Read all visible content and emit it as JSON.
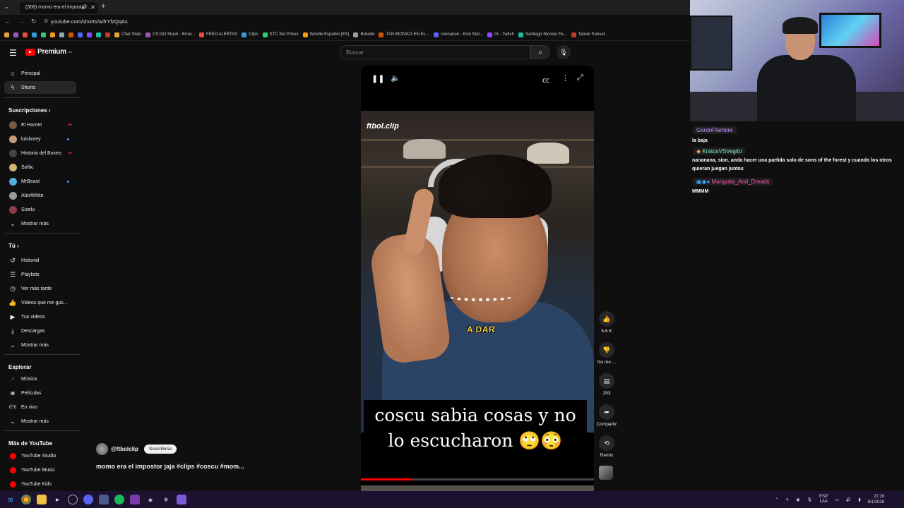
{
  "browser": {
    "tab_title": "(306) momo era el impostor ...",
    "url": "youtube.com/shorts/wifrYfzQqAs",
    "bookmarks": [
      "Chat Stats",
      "CS:GO Stash - Brow...",
      "FEED ALERTAS",
      "Clips",
      "STC Set Prices",
      "Wordle Español (ES)",
      "Boludle",
      "TAN BIONICA EN EL...",
      "coxnanon - Kick Stat...",
      "trr - Twitch",
      "Santiago Nicolas Fe...",
      "Tanuki Sunset"
    ]
  },
  "youtube": {
    "logo_text": "Premium",
    "logo_sup": "AR",
    "search_placeholder": "Buscar",
    "sidebar": {
      "main": [
        {
          "label": "Principal",
          "icon": "home-icon"
        },
        {
          "label": "Shorts",
          "icon": "shorts-icon"
        }
      ],
      "subs_header": "Suscripciones",
      "subs": [
        {
          "label": "El Hornet",
          "color": "#7a5a44"
        },
        {
          "label": "luisitorey",
          "color": "#c49b7a"
        },
        {
          "label": "Historia del Boxeo",
          "color": "#444"
        },
        {
          "label": "Softic",
          "color": "#d8b270"
        },
        {
          "label": "MrBeast",
          "color": "#4fb0d9"
        },
        {
          "label": "AlexWhite",
          "color": "#9a9a9a"
        },
        {
          "label": "Sizelu",
          "color": "#8a3d4a"
        }
      ],
      "show_more": "Mostrar más",
      "you_header": "Tú",
      "you": [
        {
          "label": "Historial",
          "icon": "history-icon"
        },
        {
          "label": "Playlists",
          "icon": "playlist-icon"
        },
        {
          "label": "Ver más tarde",
          "icon": "clock-icon"
        },
        {
          "label": "Videos que me gus...",
          "icon": "like-icon"
        },
        {
          "label": "Tus videos",
          "icon": "video-icon"
        },
        {
          "label": "Descargas",
          "icon": "download-icon"
        }
      ],
      "explore_header": "Explorar",
      "explore": [
        {
          "label": "Música",
          "icon": "music-icon"
        },
        {
          "label": "Películas",
          "icon": "film-icon"
        },
        {
          "label": "En vivo",
          "icon": "live-icon"
        }
      ],
      "more_header": "Más de YouTube",
      "more": [
        {
          "label": "YouTube Studio"
        },
        {
          "label": "YouTube Music"
        },
        {
          "label": "YouTube Kids"
        }
      ]
    },
    "short": {
      "watermark": "ftbol.clip",
      "small_caption": "A DAR",
      "caption": "coscu sabia cosas y no lo escucharon 🙄😳",
      "progress": 0.22,
      "channel": "@ftbolclip",
      "subscribe_label": "Suscribirse",
      "title": "momo era el impostor jaja #clips #coscu #mom..."
    },
    "actions": [
      {
        "label": "5.6 K",
        "icon": "thumbs-up-icon"
      },
      {
        "label": "No me ...",
        "icon": "thumbs-down-icon"
      },
      {
        "label": "293",
        "icon": "comment-icon"
      },
      {
        "label": "Compartir",
        "icon": "share-icon"
      },
      {
        "label": "Remix",
        "icon": "remix-icon"
      }
    ]
  },
  "chat": [
    {
      "user": "GordoFlambre",
      "color": "#c89bff",
      "msg": "la baja"
    },
    {
      "user": "KratosVSVegito",
      "color": "#7cf7b5",
      "msg": "nananana, sion, anda hacer una partida solo de sons of the forest y cuando los otros quieran juegan juntos"
    },
    {
      "user": "Manguita_And_Dreads",
      "color": "#ff5aa0",
      "msg": "MMMM"
    }
  ],
  "taskbar": {
    "lang1": "ESP",
    "lang2": "LAA",
    "time": "22:19",
    "date": "8/1/2026"
  }
}
